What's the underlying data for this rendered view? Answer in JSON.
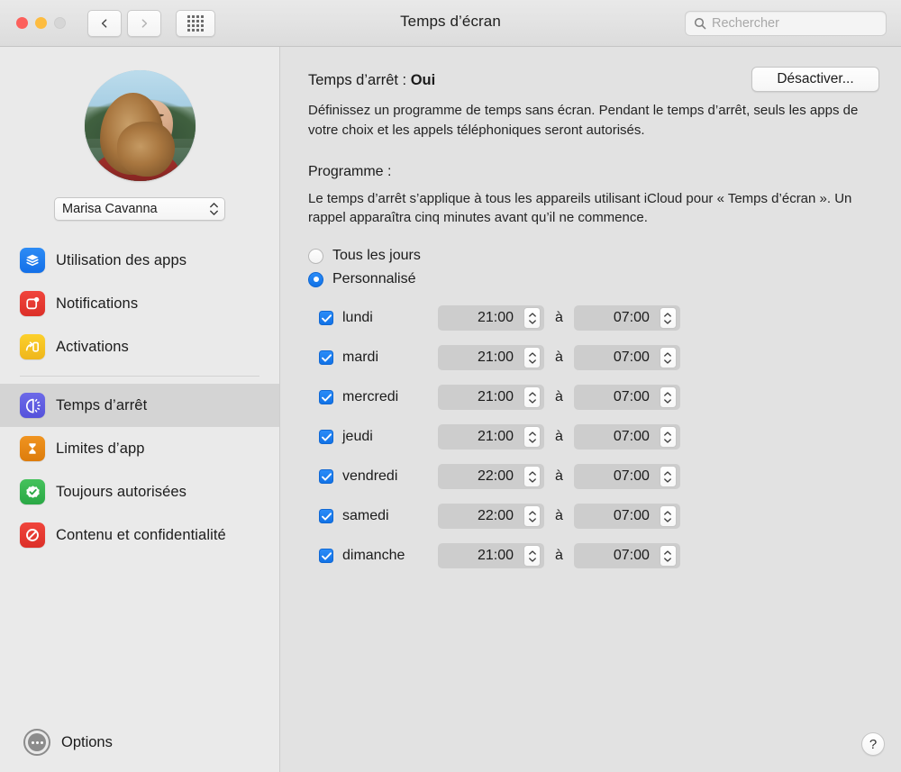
{
  "window": {
    "title": "Temps d’écran",
    "traffic_lights": [
      "close",
      "minimize",
      "zoom-disabled"
    ],
    "search": {
      "placeholder": "Rechercher",
      "value": "",
      "icon": "search-icon"
    },
    "nav": {
      "back_icon": "chevron-left-icon",
      "forward_icon": "chevron-right-icon",
      "grid_icon": "grid-icon"
    }
  },
  "sidebar": {
    "user": {
      "name": "Marisa Cavanna",
      "avatar": "user-avatar-photo"
    },
    "items": [
      {
        "label": "Utilisation des apps",
        "icon": "app-usage-icon",
        "selected": false
      },
      {
        "label": "Notifications",
        "icon": "notifications-icon",
        "selected": false
      },
      {
        "label": "Activations",
        "icon": "pickups-icon",
        "selected": false
      },
      {
        "label": "Temps d’arrêt",
        "icon": "downtime-icon",
        "selected": true
      },
      {
        "label": "Limites d’app",
        "icon": "app-limits-icon",
        "selected": false
      },
      {
        "label": "Toujours autorisées",
        "icon": "always-allowed-icon",
        "selected": false
      },
      {
        "label": "Contenu et confidentialité",
        "icon": "content-privacy-icon",
        "selected": false
      }
    ],
    "options": {
      "label": "Options",
      "icon": "options-icon"
    }
  },
  "main": {
    "status_prefix": "Temps d’arrêt : ",
    "status_value": "Oui",
    "turn_off_button": "Désactiver...",
    "description": "Définissez un programme de temps sans écran. Pendant le temps d’arrêt, seuls les apps de votre choix et les appels téléphoniques seront autorisés.",
    "schedule_title": "Programme :",
    "schedule_description": "Le temps d’arrêt s’applique à tous les appareils utilisant iCloud pour « Temps d’écran ». Un rappel apparaîtra cinq minutes avant qu’il ne commence.",
    "radios": [
      {
        "label": "Tous les jours",
        "selected": false
      },
      {
        "label": "Personnalisé",
        "selected": true
      }
    ],
    "separator_label": "à",
    "days": [
      {
        "label": "lundi",
        "checked": true,
        "from": "21:00",
        "to": "07:00"
      },
      {
        "label": "mardi",
        "checked": true,
        "from": "21:00",
        "to": "07:00"
      },
      {
        "label": "mercredi",
        "checked": true,
        "from": "21:00",
        "to": "07:00"
      },
      {
        "label": "jeudi",
        "checked": true,
        "from": "21:00",
        "to": "07:00"
      },
      {
        "label": "vendredi",
        "checked": true,
        "from": "22:00",
        "to": "07:00"
      },
      {
        "label": "samedi",
        "checked": true,
        "from": "22:00",
        "to": "07:00"
      },
      {
        "label": "dimanche",
        "checked": true,
        "from": "21:00",
        "to": "07:00"
      }
    ],
    "help_button": "?"
  },
  "colors": {
    "accent": "#1172e6",
    "sidebar_bg": "#eaeaea",
    "content_bg": "#e2e2e2",
    "selected_row": "#d4d4d4"
  }
}
